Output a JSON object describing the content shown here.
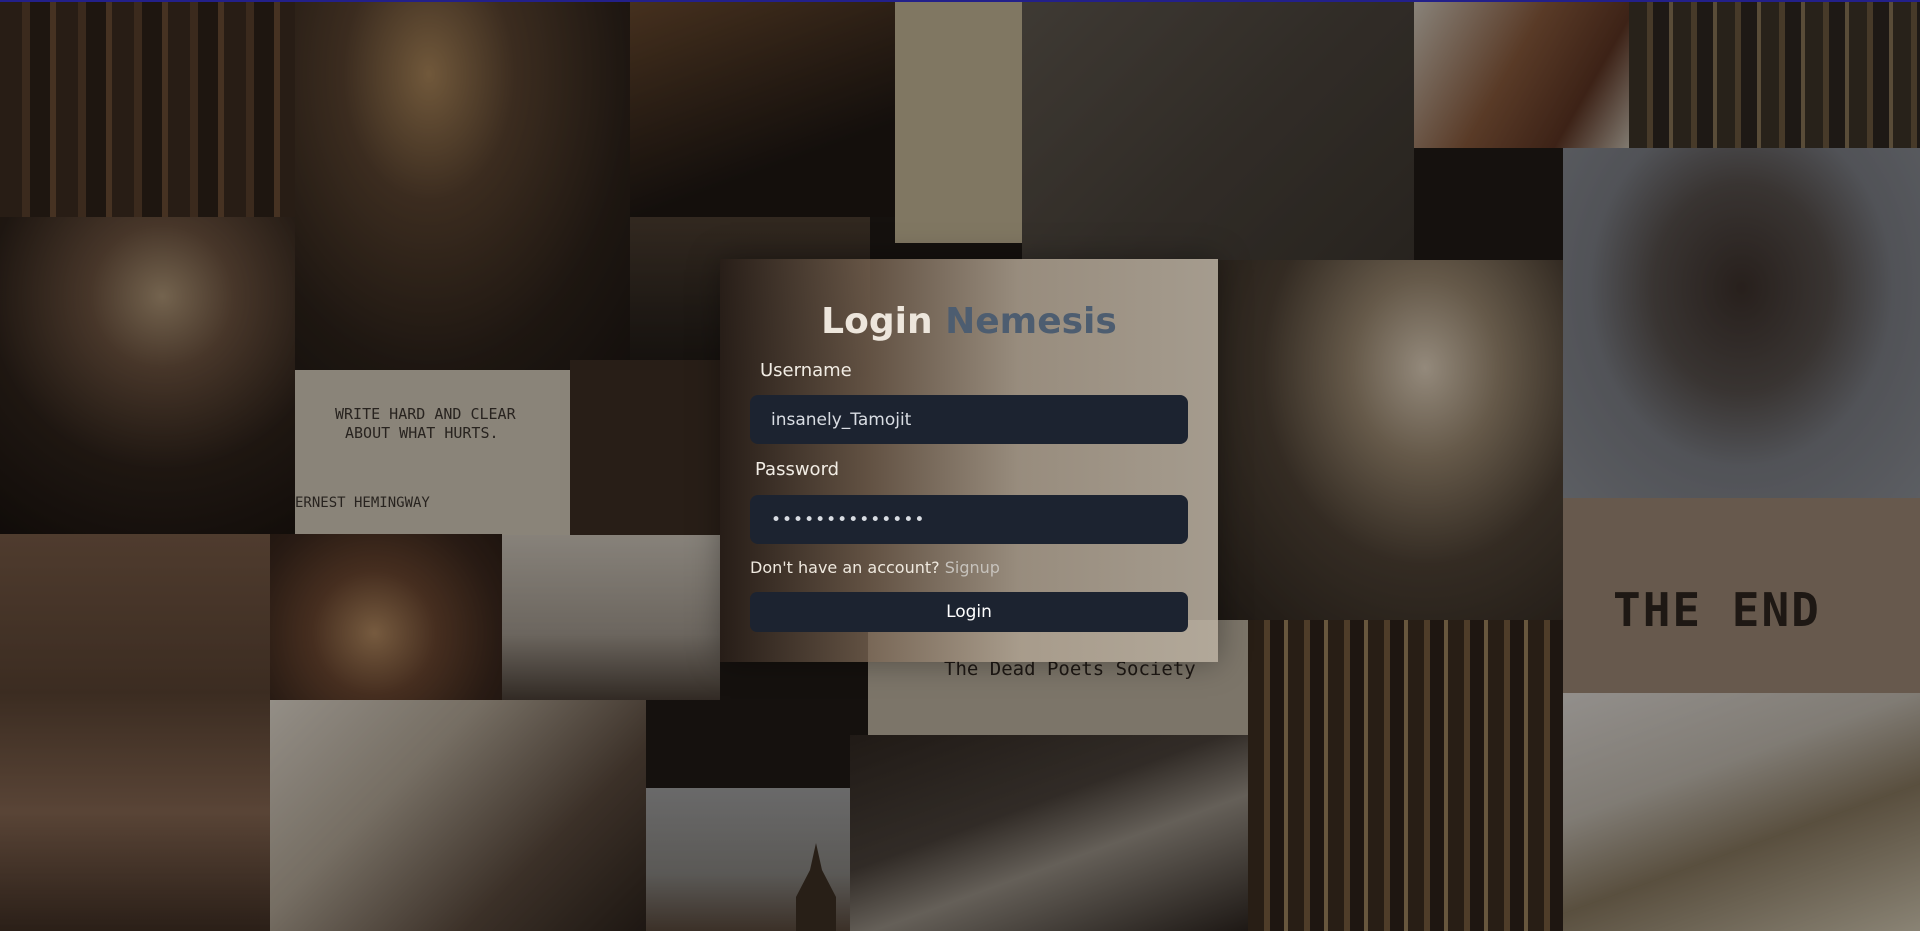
{
  "background": {
    "note_lines": [
      "WRITE HARD AND CLEAR",
      "ABOUT WHAT HURTS."
    ],
    "note_signature": "ERNEST HEMINGWAY",
    "end_card_text": "THE END",
    "dps_card_text": "The Dead Poets Society"
  },
  "login": {
    "title_part1": "Login",
    "title_part2": "Nemesis",
    "username_label": "Username",
    "username_value": "insanely_Tamojit",
    "password_label": "Password",
    "password_mask": "••••••••••••••",
    "signup_prompt": "Don't have an account?",
    "signup_link": "Signup",
    "submit_label": "Login"
  },
  "colors": {
    "card_field_bg": "#1c2330",
    "title_accent": "#4d5d70",
    "title_primary": "#ede6dc"
  }
}
